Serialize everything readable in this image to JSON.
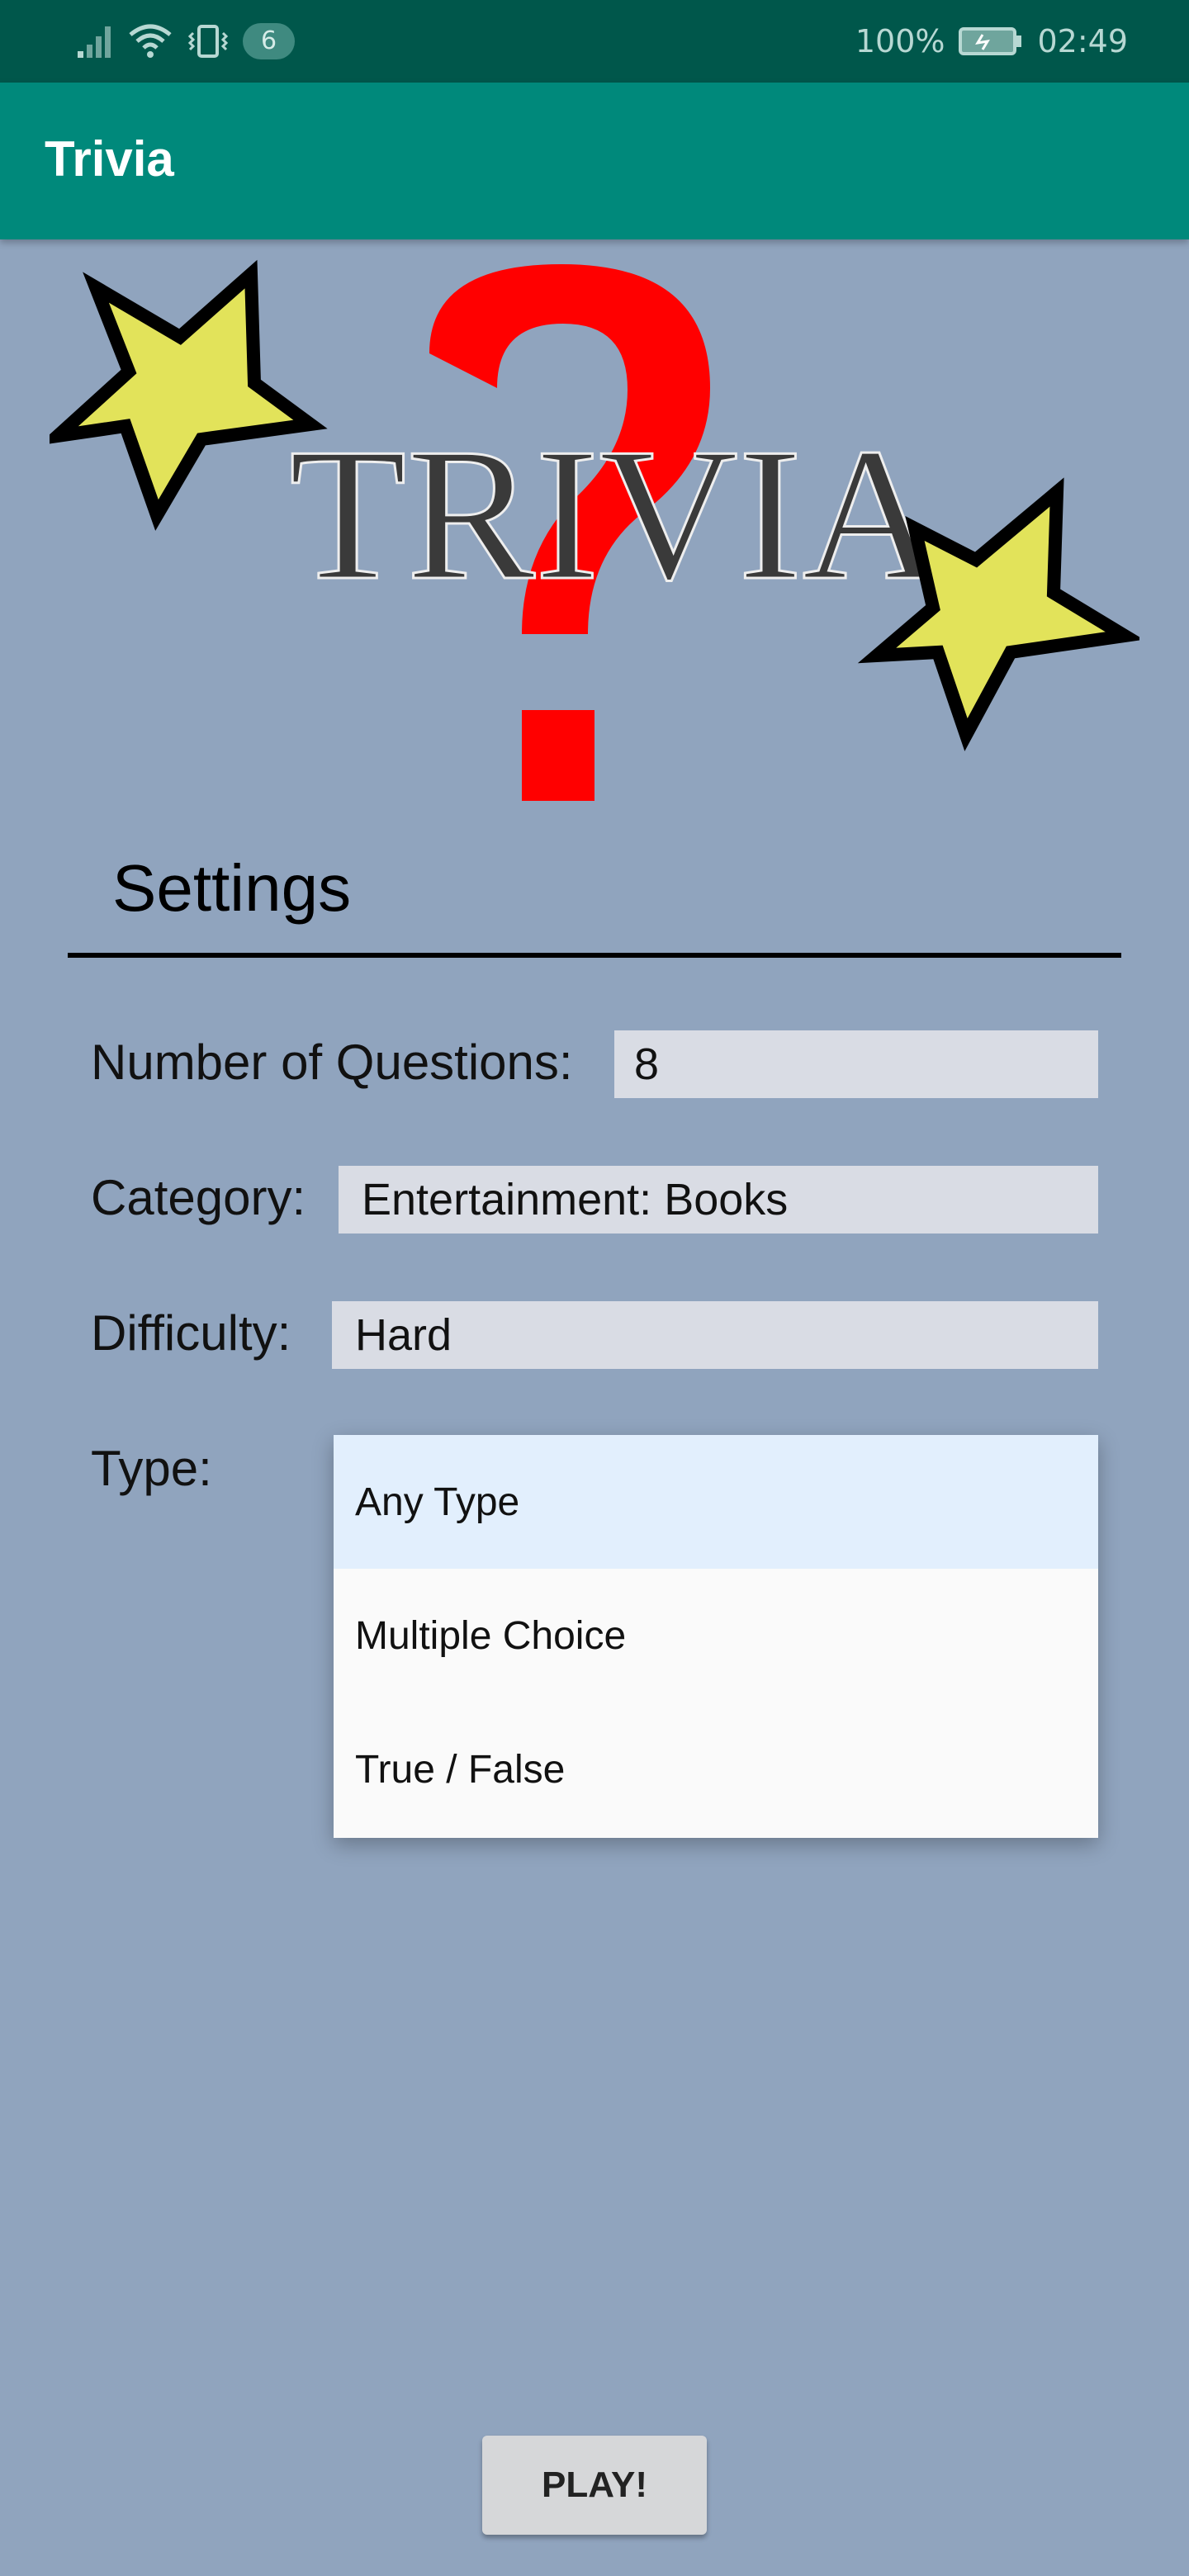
{
  "status_bar": {
    "notification_count": "6",
    "battery": "100%",
    "time": "02:49",
    "icons": [
      "signal-icon",
      "wifi-icon",
      "vibrate-icon",
      "battery-charging-icon"
    ]
  },
  "app_bar": {
    "title": "Trivia"
  },
  "logo": {
    "text": "TRIVIA",
    "colors": {
      "question_mark": "#ff0000",
      "star_fill": "#e2e35a",
      "star_outline": "#000000"
    }
  },
  "settings": {
    "title": "Settings",
    "questions": {
      "label": "Number of Questions:",
      "value": "8"
    },
    "category": {
      "label": "Category:",
      "value": "Entertainment: Books"
    },
    "difficulty": {
      "label": "Difficulty:",
      "value": "Hard"
    },
    "type": {
      "label": "Type:",
      "options": [
        "Any Type",
        "Multiple Choice",
        "True / False"
      ],
      "highlighted": "Any Type"
    }
  },
  "play_button": {
    "label": "PLAY!"
  },
  "colors": {
    "background": "#90a4be",
    "app_bar": "#00897b",
    "status_bar": "#00574b"
  }
}
